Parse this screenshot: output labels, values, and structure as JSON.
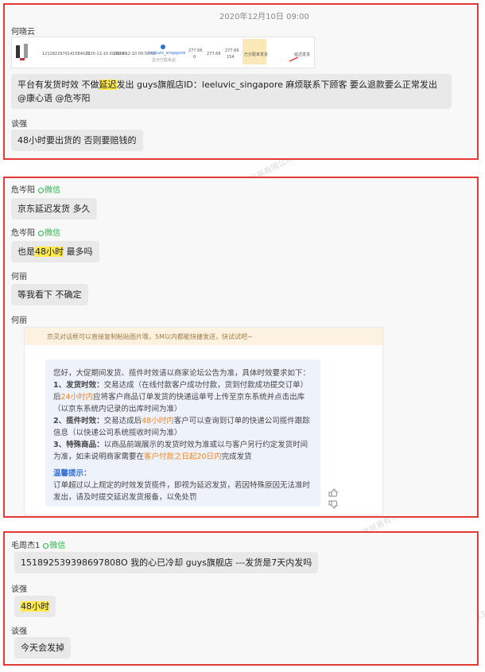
{
  "watermark": "上海瑞皓贸易有限公司咖啡豚3845",
  "section1": {
    "timestamp": "2020年12月10日 09:00",
    "messages": [
      {
        "sender": "何晓云",
        "screenshot": {
          "order_id": "1212822979141584071",
          "date1": "2020-12-10 00:50:40",
          "date2": "2020-12-10 00:56:02",
          "shop": "leeluvic_singapore",
          "shop_note": "显示已联系店",
          "v1": "277.66",
          "v1b": "0",
          "v2": "277.66",
          "v3": "277.66",
          "v3b": "154",
          "status": "已分配未发货",
          "action": "延迟发货"
        },
        "text_before": "平台有发货时效 不做",
        "highlight": "延迟",
        "text_after": "发出 guys旗舰店ID：leeluvic_singapore  麻烦联系下顾客 要么退款要么正常发出 @康心语  @危岑阳"
      },
      {
        "sender": "谈强",
        "text": "48小时要出货的 否则要赔钱的"
      }
    ]
  },
  "section2": {
    "messages": [
      {
        "sender": "危岑阳",
        "wechat": "微信",
        "text": "京东延迟发货 多久"
      },
      {
        "sender": "危岑阳",
        "wechat": "微信",
        "text_before": "也是",
        "highlight": "48小时",
        "text_after": " 最多吗"
      },
      {
        "sender": "何丽",
        "text": "等我看下 不确定"
      },
      {
        "sender": "何丽"
      }
    ],
    "policy_card": {
      "header": "京灵对话框可以直接复制粘贴图片哦，5M以内都能快捷发送，快试试吧~",
      "intro": "您好，大促期间发货、揽件时效请以商家论坛公告为准，具体时效要求如下：",
      "p1_title": "1、发货时效：",
      "p1_a": "交易达成（在线付款客户成功付款，货到付款成功提交订单）后",
      "p1_orange": "24小时内",
      "p1_b": "应将客户商品订单发货的快递运单号上传至京东系统并点击出库（以京东系统内记录的出库时间为准）",
      "p2_title": "2、揽件时效：",
      "p2_a": "交易达成后",
      "p2_orange": "48小时内",
      "p2_b": "客户可以查询到订单的快递公司揽件跟踪信息（以快递公司系统揽收时间为准）",
      "p3_title": "3、特殊商品：",
      "p3_a": "以商品前端展示的发货时效为准或以与客户另行约定发货时间为准，如未说明商家需要在",
      "p3_orange": "客户付款之日起20日内",
      "p3_b": "完成发货",
      "tip_title": "温馨提示：",
      "tip_text": "订单超过以上规定的时效发货揽件，即视为延迟发货，若因特殊原因无法准时发出，请及时提交延迟发货报备，以免处罚"
    }
  },
  "section3": {
    "messages": [
      {
        "sender": "毛周杰1",
        "wechat": "微信",
        "text": "151892539398697808O  我的心已冷却    guys旗舰店 ---发货是7天内发吗"
      },
      {
        "sender": "谈强",
        "highlight": "48小时"
      },
      {
        "sender": "谈强",
        "text": "今天会发掉"
      }
    ]
  }
}
